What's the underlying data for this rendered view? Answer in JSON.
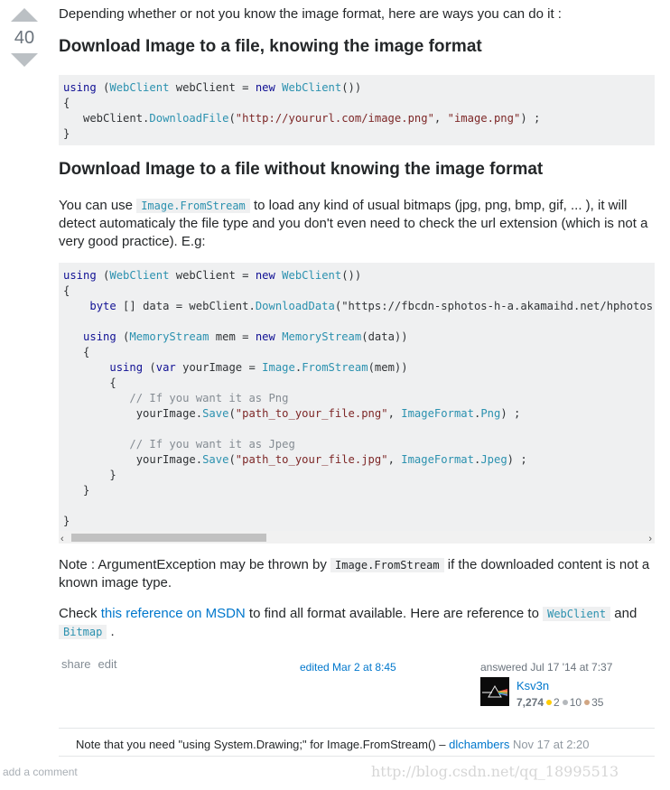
{
  "vote": {
    "count": "40"
  },
  "post": {
    "intro": "Depending whether or not you know the image format, here are ways you can do it :",
    "heading1": "Download Image to a file, knowing the image format",
    "code1_lines": [
      "using (WebClient webClient = new WebClient())",
      "{",
      "   webClient.DownloadFile(\"http://yoururl.com/image.png\", \"image.png\") ;",
      "}"
    ],
    "heading2": "Download Image to a file without knowing the image format",
    "p2_a": "You can use ",
    "p2_code": "Image.FromStream",
    "p2_b": " to load any kind of usual bitmaps (jpg, png, bmp, gif, ... ), it will detect automaticaly the file type and you don't even need to check the url extension (which is not a very good practice). E.g:",
    "code2_lines": [
      "using (WebClient webClient = new WebClient())",
      "{",
      "    byte [] data = webClient.DownloadData(\"https://fbcdn-sphotos-h-a.akamaihd.net/hphotos-ak",
      "",
      "   using (MemoryStream mem = new MemoryStream(data))",
      "   {",
      "       using (var yourImage = Image.FromStream(mem))",
      "       {",
      "          // If you want it as Png",
      "           yourImage.Save(\"path_to_your_file.png\", ImageFormat.Png) ;",
      "",
      "          // If you want it as Jpeg",
      "           yourImage.Save(\"path_to_your_file.jpg\", ImageFormat.Jpeg) ;",
      "       }",
      "   }",
      "",
      "}"
    ],
    "p3_a": "Note : ArgumentException may be thrown by ",
    "p3_code": "Image.FromStream",
    "p3_b": " if the downloaded content is not a known image type.",
    "p4_a": "Check ",
    "p4_link": "this reference on MSDN",
    "p4_b": " to find all format available. Here are reference to ",
    "p4_code1": "WebClient",
    "p4_c": " and ",
    "p4_code2": "Bitmap",
    "p4_d": " ."
  },
  "scroll": {
    "left": "‹",
    "right": "›"
  },
  "menu": {
    "share": "share",
    "edit": "edit"
  },
  "edited": "edited Mar 2 at 8:45",
  "answered": {
    "label": "answered Jul 17 '14 at 7:37",
    "user": "Ksv3n",
    "rep": "7,274",
    "gold": "2",
    "silver": "10",
    "bronze": "35"
  },
  "comment": {
    "text": "Note that you need \"using System.Drawing;\" for Image.FromStream() – ",
    "user": "dlchambers",
    "date": " Nov 17 at 2:20"
  },
  "add_comment": "add a comment",
  "watermark": "http://blog.csdn.net/qq_18995513",
  "colors": {
    "link": "#0077cc",
    "code_bg": "#eff0f1",
    "arrow": "#bbc0c4"
  }
}
